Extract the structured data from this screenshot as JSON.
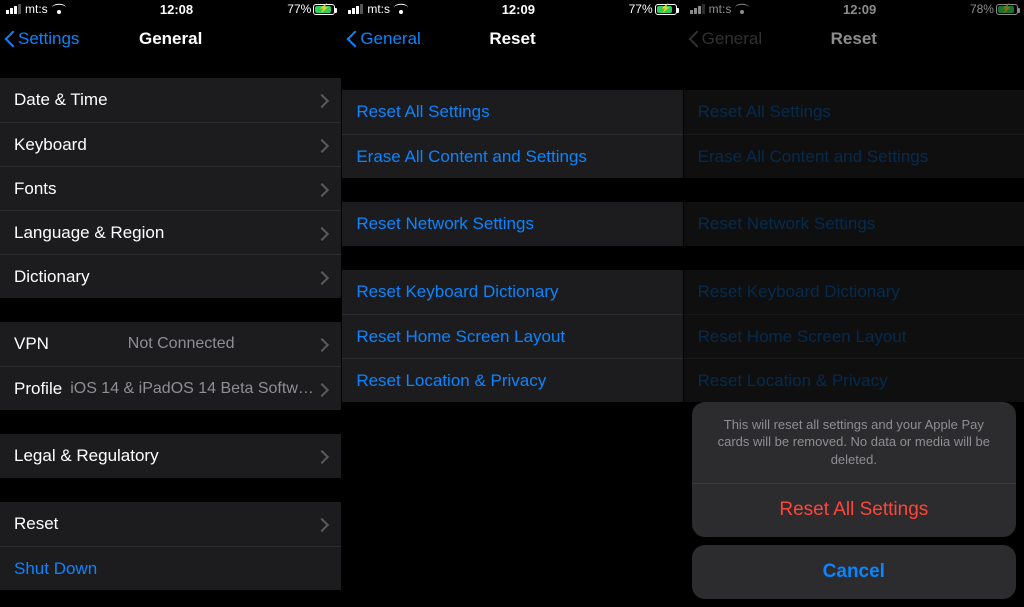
{
  "panels": [
    {
      "status": {
        "carrier": "mt:s",
        "clock": "12:08",
        "battery_pct": "77%",
        "battery_fill": 77
      },
      "nav": {
        "back": "Settings",
        "title": "General"
      },
      "group1": [
        {
          "label": "Date & Time"
        },
        {
          "label": "Keyboard"
        },
        {
          "label": "Fonts"
        },
        {
          "label": "Language & Region"
        },
        {
          "label": "Dictionary"
        }
      ],
      "group2": [
        {
          "label": "VPN",
          "value": "Not Connected"
        },
        {
          "label": "Profile",
          "value": "iOS 14 & iPadOS 14 Beta Softwar…"
        }
      ],
      "group3": [
        {
          "label": "Legal & Regulatory"
        }
      ],
      "group4": [
        {
          "label": "Reset"
        },
        {
          "label": "Shut Down",
          "link": true
        }
      ]
    },
    {
      "status": {
        "carrier": "mt:s",
        "clock": "12:09",
        "battery_pct": "77%",
        "battery_fill": 77
      },
      "nav": {
        "back": "General",
        "title": "Reset"
      },
      "groupA": [
        "Reset All Settings",
        "Erase All Content and Settings"
      ],
      "groupB": [
        "Reset Network Settings"
      ],
      "groupC": [
        "Reset Keyboard Dictionary",
        "Reset Home Screen Layout",
        "Reset Location & Privacy"
      ]
    },
    {
      "status": {
        "carrier": "mt:s",
        "clock": "12:09",
        "battery_pct": "78%",
        "battery_fill": 78
      },
      "nav": {
        "back": "General",
        "title": "Reset"
      },
      "groupA": [
        "Reset All Settings",
        "Erase All Content and Settings"
      ],
      "groupB": [
        "Reset Network Settings"
      ],
      "groupC": [
        "Reset Keyboard Dictionary",
        "Reset Home Screen Layout",
        "Reset Location & Privacy"
      ],
      "sheet": {
        "message": "This will reset all settings and your Apple Pay cards will be removed. No data or media will be deleted.",
        "destructive": "Reset All Settings",
        "cancel": "Cancel"
      }
    }
  ]
}
